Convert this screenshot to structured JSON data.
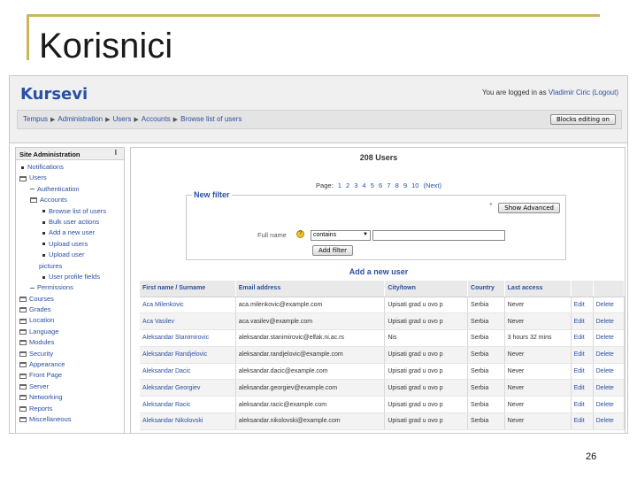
{
  "slide": {
    "title": "Korisnici",
    "number": "26"
  },
  "site": {
    "name": "Kursevi",
    "login_prefix": "You are logged in as",
    "user": "Vladimir Ciric",
    "logout": "(Logout)"
  },
  "breadcrumb": [
    "Tempus",
    "Administration",
    "Users",
    "Accounts",
    "Browse list of users"
  ],
  "blocks_button": "Blocks editing on",
  "sidebar": {
    "title": "Site Administration",
    "close": "I",
    "items": [
      "Notifications",
      "Users",
      "Authentication",
      "Accounts",
      "Browse list of users",
      "Bulk user actions",
      "Add a new user",
      "Upload users",
      "Upload user",
      "pictures",
      "User profile fields",
      "Permissions",
      "Courses",
      "Grades",
      "Location",
      "Language",
      "Modules",
      "Security",
      "Appearance",
      "Front Page",
      "Server",
      "Networking",
      "Reports",
      "Miscellaneous"
    ]
  },
  "main": {
    "title": "208 Users",
    "paging_label": "Page:",
    "pages": [
      "1",
      "2",
      "3",
      "4",
      "5",
      "6",
      "7",
      "8",
      "9",
      "10",
      "(Next)"
    ],
    "filter_title": "New filter",
    "show_advanced": "Show Advanced",
    "fullname_label": "Full name",
    "operator": "contains",
    "add_filter": "Add filter",
    "add_user": "Add a new user"
  },
  "table": {
    "headers": [
      "First name / Surname",
      "Email address",
      "City/town",
      "Country",
      "Last access",
      "",
      ""
    ],
    "rows": [
      [
        "Aca Milenkovic",
        "aca.milenkovic@example.com",
        "Upisati grad u ovo p",
        "Serbia",
        "Never",
        "Edit",
        "Delete"
      ],
      [
        "Aca Vasilev",
        "aca.vasilev@example.com",
        "Upisati grad u ovo p",
        "Serbia",
        "Never",
        "Edit",
        "Delete"
      ],
      [
        "Aleksandar Stanimirovic",
        "aleksandar.stanimirovic@elfak.ni.ac.rs",
        "Nis",
        "Serbia",
        "3 hours 32 mins",
        "Edit",
        "Delete"
      ],
      [
        "Aleksandar Randjelovic",
        "aleksandar.randjelovic@example.com",
        "Upisati grad u ovo p",
        "Serbia",
        "Never",
        "Edit",
        "Delete"
      ],
      [
        "Aleksandar Dacic",
        "aleksandar.dacic@example.com",
        "Upisati grad u ovo p",
        "Serbia",
        "Never",
        "Edit",
        "Delete"
      ],
      [
        "Aleksandar Georgiev",
        "aleksandar.georgiev@example.com",
        "Upisati grad u ovo p",
        "Serbia",
        "Never",
        "Edit",
        "Delete"
      ],
      [
        "Aleksandar Racic",
        "aleksandar.racic@example.com",
        "Upisati grad u ovo p",
        "Serbia",
        "Never",
        "Edit",
        "Delete"
      ],
      [
        "Aleksandar Nikolovski",
        "aleksandar.nikolovski@example.com",
        "Upisati grad u ovo p",
        "Serbia",
        "Never",
        "Edit",
        "Delete"
      ]
    ]
  }
}
